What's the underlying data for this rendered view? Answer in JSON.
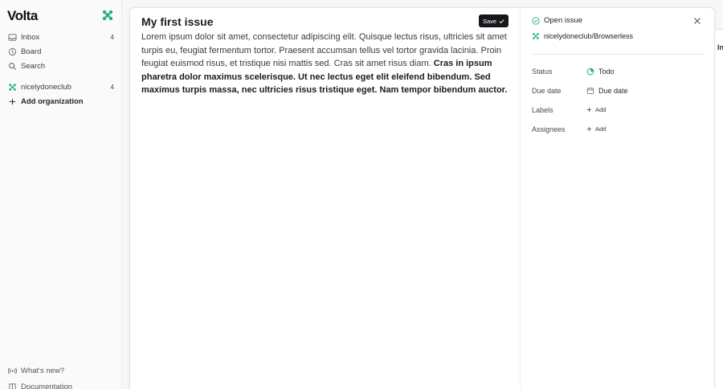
{
  "app": {
    "logo_text": "Volta"
  },
  "sidebar": {
    "items": [
      {
        "label": "Inbox",
        "count": "4",
        "icon": "inbox-icon"
      },
      {
        "label": "Board",
        "icon": "board-icon"
      },
      {
        "label": "Search",
        "icon": "search-icon"
      }
    ],
    "org": {
      "label": "nicelydoneclub",
      "count": "4",
      "icon": "org-icon"
    },
    "add_org_label": "Add organization",
    "bottom": [
      {
        "label": "What's new?",
        "icon": "broadcast-icon"
      },
      {
        "label": "Documentation",
        "icon": "book-icon"
      }
    ]
  },
  "background": {
    "partial_label": "In"
  },
  "issue": {
    "title": "My first issue",
    "save_label": "Save",
    "description_plain": "Lorem ipsum dolor sit amet, consectetur adipiscing elit. Quisque lectus risus, ultricies sit amet turpis eu, feugiat fermentum tortor. Praesent accumsan tellus vel tortor gravida lacinia. Proin feugiat euismod risus, et tristique nisi mattis sed. Cras sit amet risus diam. ",
    "description_bold": "Cras in ipsum pharetra dolor maximus scelerisque. Ut nec lectus eget elit eleifend bibendum. Sed maximus turpis massa, nec ultricies risus tristique eget. Nam tempor bibendum auctor."
  },
  "details": {
    "status_text": "Open issue",
    "repo": "nicelydoneclub/Browserless",
    "properties": {
      "status_label": "Status",
      "status_value": "Todo",
      "due_label": "Due date",
      "due_value": "Due date",
      "labels_label": "Labels",
      "labels_add": "Add",
      "assignees_label": "Assignees",
      "assignees_add": "Add"
    }
  },
  "colors": {
    "accent_green": "#22b07d",
    "button_dark": "#18181c"
  }
}
